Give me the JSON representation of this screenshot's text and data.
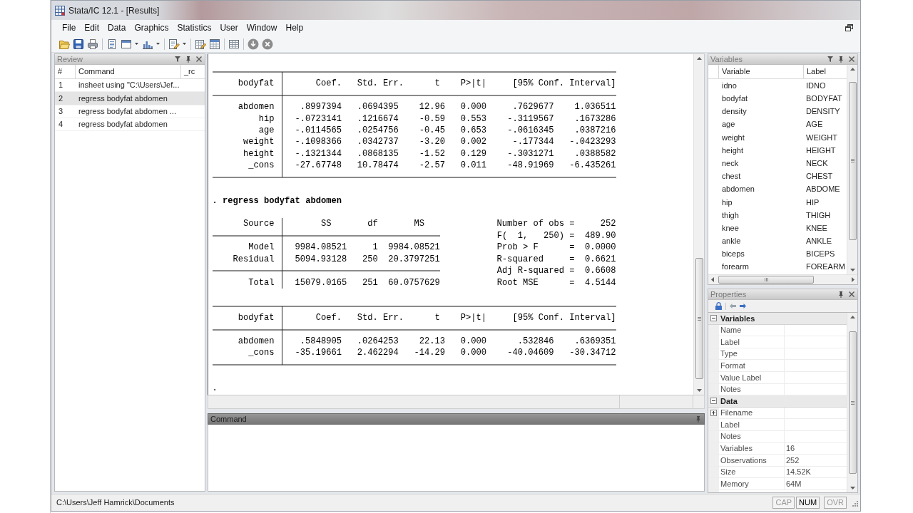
{
  "window": {
    "title": "Stata/IC 12.1 - [Results]"
  },
  "menu": [
    "File",
    "Edit",
    "Data",
    "Graphics",
    "Statistics",
    "User",
    "Window",
    "Help"
  ],
  "review": {
    "title": "Review",
    "focused": false,
    "columns": [
      "#",
      "Command",
      "_rc"
    ],
    "rows": [
      {
        "number": "1",
        "command": "insheet using \"C:\\Users\\Jef...",
        "selected": false
      },
      {
        "number": "2",
        "command": "regress bodyfat abdomen",
        "selected": true
      },
      {
        "number": "3",
        "command": "regress bodyfat abdomen ...",
        "selected": false
      },
      {
        "number": "4",
        "command": "regress bodyfat abdomen",
        "selected": false
      }
    ]
  },
  "results": {
    "blocks": [
      {
        "kind": "coef_table",
        "depvar": "bodyfat",
        "headers": [
          "Coef.",
          "Std. Err.",
          "t",
          "P>|t|",
          "[95% Conf. Interval]"
        ],
        "rows": [
          {
            "name": "abdomen",
            "values": [
              ".8997394",
              ".0694395",
              "12.96",
              "0.000",
              ".7629677",
              "1.036511"
            ]
          },
          {
            "name": "hip",
            "values": [
              "-.0723141",
              ".1216674",
              "-0.59",
              "0.553",
              "-.3119567",
              ".1673286"
            ]
          },
          {
            "name": "age",
            "values": [
              "-.0114565",
              ".0254756",
              "-0.45",
              "0.653",
              "-.0616345",
              ".0387216"
            ]
          },
          {
            "name": "weight",
            "values": [
              "-.1098366",
              ".0342737",
              "-3.20",
              "0.002",
              "-.177344",
              "-.0423293"
            ]
          },
          {
            "name": "height",
            "values": [
              "-.1321344",
              ".0868135",
              "-1.52",
              "0.129",
              "-.3031271",
              ".0388582"
            ]
          },
          {
            "name": "_cons",
            "values": [
              "-27.67748",
              "10.78474",
              "-2.57",
              "0.011",
              "-48.91969",
              "-6.435261"
            ]
          }
        ]
      },
      {
        "kind": "command",
        "text": ". regress bodyfat abdomen"
      },
      {
        "kind": "anova_table",
        "headers": [
          "Source",
          "SS",
          "df",
          "MS"
        ],
        "rows": [
          {
            "name": "Model",
            "values": [
              "9984.08521",
              "1",
              "9984.08521"
            ]
          },
          {
            "name": "Residual",
            "values": [
              "5094.93128",
              "250",
              "20.3797251"
            ]
          }
        ],
        "total": {
          "name": "Total",
          "values": [
            "15079.0165",
            "251",
            "60.0757629"
          ]
        },
        "stats": [
          {
            "label": "Number of obs",
            "eq": "=",
            "value": "252"
          },
          {
            "label": "F(  1,   250)",
            "eq": "=",
            "value": "489.90"
          },
          {
            "label": "Prob > F",
            "eq": "=",
            "value": "0.0000"
          },
          {
            "label": "R-squared",
            "eq": "=",
            "value": "0.6621"
          },
          {
            "label": "Adj R-squared",
            "eq": "=",
            "value": "0.6608"
          },
          {
            "label": "Root MSE",
            "eq": "=",
            "value": "4.5144"
          }
        ]
      },
      {
        "kind": "coef_table",
        "depvar": "bodyfat",
        "headers": [
          "Coef.",
          "Std. Err.",
          "t",
          "P>|t|",
          "[95% Conf. Interval]"
        ],
        "rows": [
          {
            "name": "abdomen",
            "values": [
              ".5848905",
              ".0264253",
              "22.13",
              "0.000",
              ".532846",
              ".6369351"
            ]
          },
          {
            "name": "_cons",
            "values": [
              "-35.19661",
              "2.462294",
              "-14.29",
              "0.000",
              "-40.04609",
              "-30.34712"
            ]
          }
        ]
      },
      {
        "kind": "prompt",
        "text": "."
      }
    ]
  },
  "command_window": {
    "title": "Command",
    "focused": true
  },
  "variables": {
    "title": "Variables",
    "focused": false,
    "columns": [
      "Variable",
      "Label"
    ],
    "rows": [
      {
        "name": "idno",
        "label": "IDNO"
      },
      {
        "name": "bodyfat",
        "label": "BODYFAT"
      },
      {
        "name": "density",
        "label": "DENSITY"
      },
      {
        "name": "age",
        "label": "AGE"
      },
      {
        "name": "weight",
        "label": "WEIGHT"
      },
      {
        "name": "height",
        "label": "HEIGHT"
      },
      {
        "name": "neck",
        "label": "NECK"
      },
      {
        "name": "chest",
        "label": "CHEST"
      },
      {
        "name": "abdomen",
        "label": "ABDOME"
      },
      {
        "name": "hip",
        "label": "HIP"
      },
      {
        "name": "thigh",
        "label": "THIGH"
      },
      {
        "name": "knee",
        "label": "KNEE"
      },
      {
        "name": "ankle",
        "label": "ANKLE"
      },
      {
        "name": "biceps",
        "label": "BICEPS"
      },
      {
        "name": "forearm",
        "label": "FOREARM"
      }
    ]
  },
  "properties": {
    "title": "Properties",
    "focused": false,
    "sections": [
      {
        "title": "Variables",
        "expanded": true,
        "rows": [
          {
            "kind": "field",
            "name": "Name"
          },
          {
            "kind": "field",
            "name": "Label"
          },
          {
            "kind": "field",
            "name": "Type"
          },
          {
            "kind": "field",
            "name": "Format"
          },
          {
            "kind": "field",
            "name": "Value Label"
          },
          {
            "kind": "field",
            "name": "Notes"
          }
        ]
      },
      {
        "title": "Data",
        "expanded": true,
        "rows": [
          {
            "kind": "expandable",
            "expanded": false,
            "name": "Filename"
          },
          {
            "kind": "field",
            "name": "Label"
          },
          {
            "kind": "field",
            "name": "Notes"
          },
          {
            "kind": "field",
            "name": "Variables",
            "value": "16"
          },
          {
            "kind": "field",
            "name": "Observations",
            "value": "252"
          },
          {
            "kind": "field",
            "name": "Size",
            "value": "14.52K"
          },
          {
            "kind": "field",
            "name": "Memory",
            "value": "64M"
          }
        ]
      }
    ]
  },
  "status_bar": {
    "path": "C:\\Users\\Jeff Hamrick\\Documents",
    "indicators": [
      {
        "label": "CAP",
        "on": false
      },
      {
        "label": "NUM",
        "on": true
      },
      {
        "label": "OVR",
        "on": false
      }
    ]
  }
}
